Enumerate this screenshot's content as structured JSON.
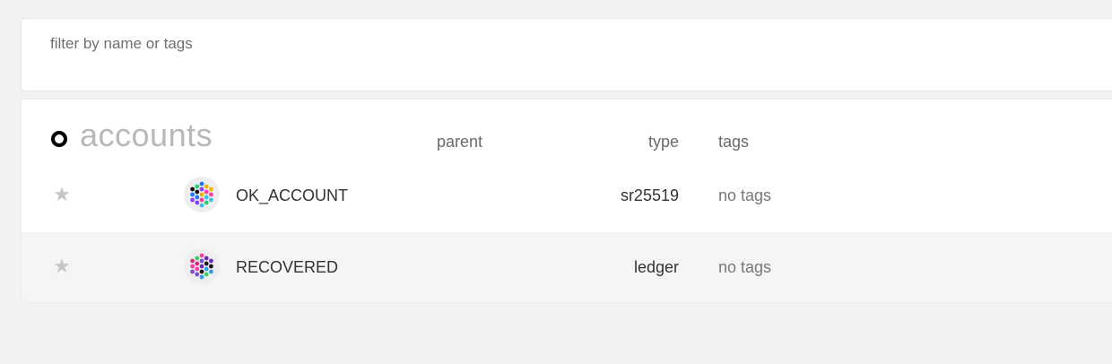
{
  "filter": {
    "placeholder": "filter by name or tags",
    "value": ""
  },
  "section": {
    "title": "accounts",
    "columns": {
      "parent": "parent",
      "type": "type",
      "tags": "tags"
    }
  },
  "accounts": [
    {
      "name": "OK_ACCOUNT",
      "parent": "",
      "type": "sr25519",
      "tags": "no tags",
      "favorite_icon": "star-icon",
      "identicon": "polkadot-identicon",
      "colors": [
        "#1f77ff",
        "#2bd16f",
        "#ff3fa0",
        "#8a3ffc",
        "#111111",
        "#38c4e8",
        "#f2b600"
      ]
    },
    {
      "name": "RECOVERED",
      "parent": "",
      "type": "ledger",
      "tags": "no tags",
      "favorite_icon": "star-icon",
      "identicon": "polkadot-identicon",
      "colors": [
        "#6b2bbf",
        "#ff3ea5",
        "#3ad05c",
        "#1a1a1a",
        "#7c4bd8",
        "#d12f7a",
        "#2f9fe6"
      ]
    }
  ],
  "colors": {
    "background": "#f2f2f2",
    "card": "#ffffff",
    "row_alt": "#f5f5f5",
    "star": "#c6c6c6",
    "section_title": "#b8b8b8"
  }
}
